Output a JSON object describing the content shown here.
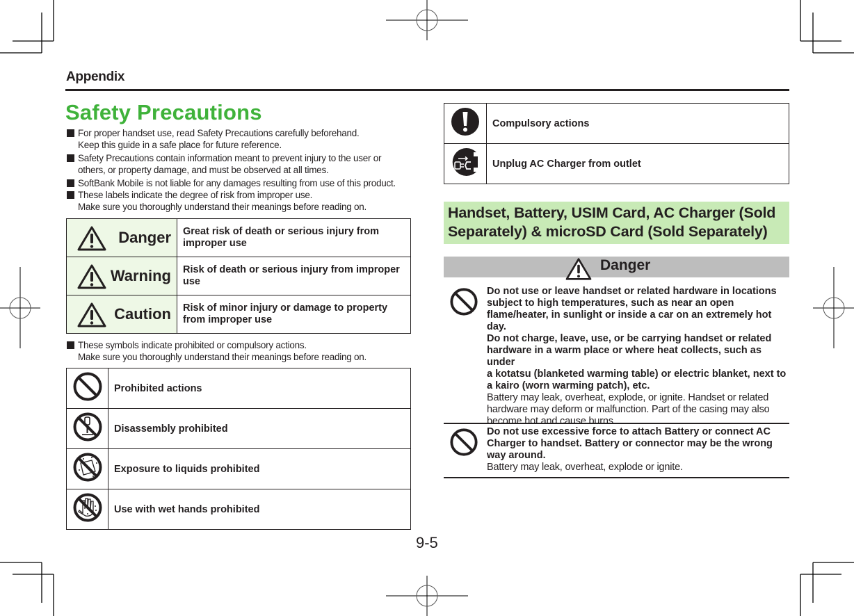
{
  "header": {
    "section": "Appendix",
    "page_number": "9-5"
  },
  "title": "Safety Precautions",
  "intro_bullets": [
    {
      "lines": [
        "For proper handset use, read Safety Precautions carefully beforehand.",
        "Keep this guide in a safe place for future reference."
      ]
    },
    {
      "lines": [
        "Safety Precautions contain information meant to prevent injury to the user or",
        "others, or property damage, and must be observed at all times."
      ]
    },
    {
      "lines": [
        "SoftBank Mobile is not liable for any damages resulting from use of this product."
      ]
    },
    {
      "lines": [
        "These labels indicate the degree of risk from improper use.",
        "Make sure you thoroughly understand their meanings before reading on."
      ]
    }
  ],
  "risk_levels": [
    {
      "icon": "warning-triangle-icon",
      "level": "Danger",
      "description": "Great risk of death or serious injury from improper use"
    },
    {
      "icon": "warning-triangle-icon",
      "level": "Warning",
      "description": "Risk of death or serious injury from improper use"
    },
    {
      "icon": "warning-triangle-icon",
      "level": "Caution",
      "description": "Risk of minor injury or damage to property from improper use"
    }
  ],
  "symbols_bullet": {
    "lines": [
      "These symbols indicate prohibited or compulsory actions.",
      "Make sure you thoroughly understand their meanings before reading on."
    ]
  },
  "symbols": [
    {
      "icon": "prohibited-icon",
      "label": "Prohibited actions"
    },
    {
      "icon": "disassembly-prohibited-icon",
      "label": "Disassembly prohibited"
    },
    {
      "icon": "liquids-prohibited-icon",
      "label": "Exposure to liquids prohibited"
    },
    {
      "icon": "wet-hands-prohibited-icon",
      "label": "Use with wet hands prohibited"
    },
    {
      "icon": "compulsory-icon",
      "label": "Compulsory actions"
    },
    {
      "icon": "unplug-charger-icon",
      "label": "Unplug AC Charger from outlet"
    }
  ],
  "section_heading": {
    "lines": [
      "Handset, Battery, USIM Card, AC Charger (Sold",
      "Separately) & microSD Card (Sold Separately)"
    ]
  },
  "danger_banner": {
    "icon": "warning-triangle-icon",
    "label": "Danger"
  },
  "danger_items": [
    {
      "icon": "prohibited-icon",
      "bold_lines": [
        "Do not use or leave handset or related hardware in locations",
        "subject to high temperatures, such as near an open",
        "flame/heater, in sunlight or inside a car on an extremely hot",
        "day.",
        "Do not charge, leave, use, or be carrying handset or related",
        "hardware in a warm place or where heat collects, such as under",
        "a kotatsu (blanketed warming table) or electric blanket, next to",
        "a kairo (worn warming patch), etc."
      ],
      "normal_lines": [
        "Battery may leak, overheat, explode, or ignite. Handset or related",
        "hardware may deform or malfunction. Part of the casing may also",
        "become hot and cause burns."
      ]
    },
    {
      "icon": "prohibited-icon",
      "bold_lines": [
        "Do not use excessive force to attach Battery or connect AC",
        "Charger to handset. Battery or connector may be the wrong",
        "way around."
      ],
      "normal_lines": [
        "Battery may leak, overheat, explode or ignite."
      ]
    }
  ],
  "colors": {
    "title_green": "#3fb23a",
    "section_heading_bg": "#c8eab6",
    "risk_label_bg": "#eef8e6",
    "danger_banner_bg": "#bdbdbd",
    "text": "#231f20"
  }
}
